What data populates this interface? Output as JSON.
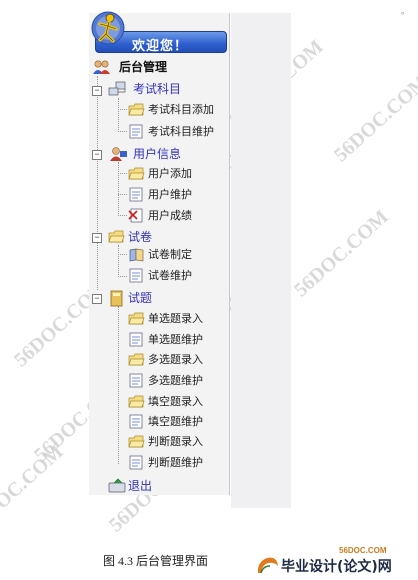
{
  "corner_mark": "。",
  "header": {
    "welcome": "欢迎您！"
  },
  "root": {
    "label": "后台管理"
  },
  "groups": [
    {
      "label": "考试科目",
      "items": [
        "考试科目添加",
        "考试科目维护"
      ]
    },
    {
      "label": "用户信息",
      "items": [
        "用户添加",
        "用户维护",
        "用户成绩"
      ]
    },
    {
      "label": "试卷",
      "items": [
        "试卷制定",
        "试卷维护"
      ]
    },
    {
      "label": "试题",
      "items": [
        "单选题录入",
        "单选题维护",
        "多选题录入",
        "多选题维护",
        "填空题录入",
        "填空题维护",
        "判断题录入",
        "判断题维护"
      ]
    }
  ],
  "exit": {
    "label": "退出"
  },
  "caption": "图 4.3  后台管理界面",
  "watermark": "56DOC.COM",
  "logo": {
    "site": "56DOC.COM",
    "name": "毕业设计(论文)网"
  },
  "colors": {
    "title_bar": "#2f5fcf",
    "group_label": "#3333bb",
    "panel_bg": "#f3f3f3"
  }
}
